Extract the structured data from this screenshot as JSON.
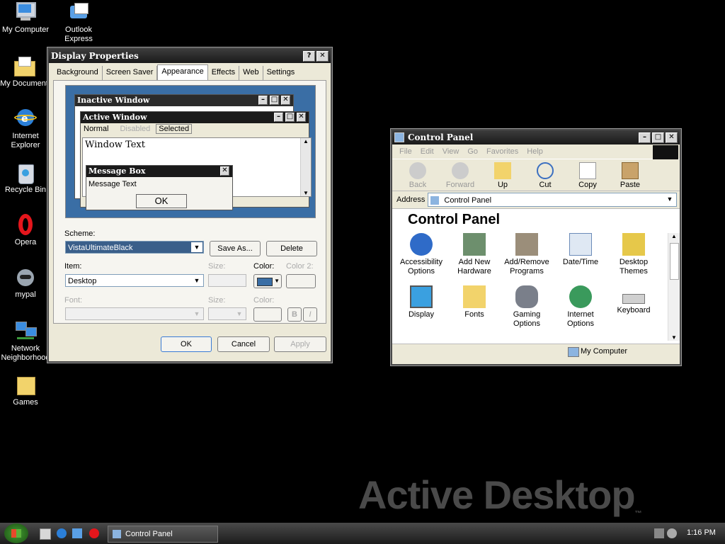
{
  "desktop": {
    "icons": [
      {
        "label": "My Computer"
      },
      {
        "label": "Outlook Express"
      },
      {
        "label": "My Document"
      },
      {
        "label": "Internet Explorer"
      },
      {
        "label": "Recycle Bin"
      },
      {
        "label": "Opera"
      },
      {
        "label": "mypal"
      },
      {
        "label": "Network Neighborhood"
      },
      {
        "label": "Games"
      }
    ],
    "watermark": "Active Desktop",
    "watermark_suffix": "™"
  },
  "display_properties": {
    "title": "Display Properties",
    "tabs": [
      "Background",
      "Screen Saver",
      "Appearance",
      "Effects",
      "Web",
      "Settings"
    ],
    "active_tab": "Appearance",
    "preview": {
      "inactive_title": "Inactive Window",
      "active_title": "Active Window",
      "menu_normal": "Normal",
      "menu_disabled": "Disabled",
      "menu_selected": "Selected",
      "window_text": "Window Text",
      "msgbox_title": "Message Box",
      "msgbox_text": "Message Text",
      "msgbox_ok": "OK"
    },
    "scheme_label": "Scheme:",
    "scheme_value": "VistaUltimateBlack",
    "save_as": "Save As...",
    "delete": "Delete",
    "item_label": "Item:",
    "item_value": "Desktop",
    "size_label": "Size:",
    "color_label": "Color:",
    "color2_label": "Color 2:",
    "font_label": "Font:",
    "size2_label": "Size:",
    "color3_label": "Color:",
    "bold": "B",
    "italic": "I",
    "ok": "OK",
    "cancel": "Cancel",
    "apply": "Apply",
    "colors": {
      "desktop_color": "#3a6ea5"
    }
  },
  "control_panel": {
    "title": "Control Panel",
    "menu": [
      "File",
      "Edit",
      "View",
      "Go",
      "Favorites",
      "Help"
    ],
    "toolbar": [
      "Back",
      "Forward",
      "Up",
      "Cut",
      "Copy",
      "Paste"
    ],
    "address_label": "Address",
    "address_value": "Control Panel",
    "heading": "Control Panel",
    "items": [
      {
        "label": "Accessibility Options",
        "icon": "accessibility-icon"
      },
      {
        "label": "Add New Hardware",
        "icon": "hardware-icon"
      },
      {
        "label": "Add/Remove Programs",
        "icon": "programs-icon"
      },
      {
        "label": "Date/Time",
        "icon": "calendar-icon"
      },
      {
        "label": "Desktop Themes",
        "icon": "themes-icon"
      },
      {
        "label": "Display",
        "icon": "display-icon"
      },
      {
        "label": "Fonts",
        "icon": "fonts-icon"
      },
      {
        "label": "Gaming Options",
        "icon": "gamepad-icon"
      },
      {
        "label": "Internet Options",
        "icon": "globe-icon"
      },
      {
        "label": "Keyboard",
        "icon": "keyboard-icon"
      }
    ],
    "status": "My Computer"
  },
  "taskbar": {
    "task_label": "Control Panel",
    "clock": "1:16 PM"
  }
}
